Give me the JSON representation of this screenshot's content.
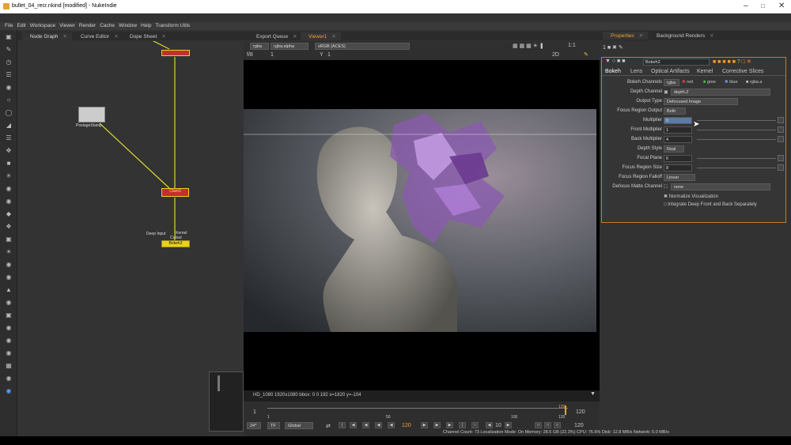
{
  "window": {
    "title": "bullet_04_recr.nkind [modified] - NukeIndie"
  },
  "menu": [
    "File",
    "Edit",
    "Workspace",
    "Viewer",
    "Render",
    "Cache",
    "Window",
    "Help",
    "Transform Utils"
  ],
  "left_tabs": {
    "node_graph": "Node Graph",
    "curve_editor": "Curve Editor",
    "dope_sheet": "Dope Sheet"
  },
  "center_tabs": {
    "export_queue": "Export Queue",
    "viewer": "Viewer1"
  },
  "right_tabs": {
    "properties": "Properties",
    "background_renders": "Background Renders"
  },
  "nodes": {
    "postage": "PostageStamp",
    "merge": "Clam3",
    "bokeh": "Bokeh2",
    "deep_label": "Deep Input",
    "kernel_label": "Kernel",
    "cutout_label": "Cutout"
  },
  "viewer": {
    "channel_set": "rgba",
    "alpha": "rgba.alpha",
    "colorspace": "sRGB (ACES)",
    "fstop": "f/8",
    "gain": "1",
    "y_label": "Y",
    "gamma": "1",
    "zoom": "1:1",
    "view_mode": "2D",
    "info": "HD_1080 1920x1080  bbox: 0 0 192  x=1820 y=-104"
  },
  "timeline": {
    "start": "1",
    "end": "120",
    "tick_50": "50",
    "tick_100": "100",
    "tick_120": "120",
    "current": "120",
    "fps": "24*",
    "tf": "TF",
    "scope": "Global",
    "frame": "120",
    "step": "10",
    "out_frame": "120",
    "playhead": 0.992
  },
  "properties": {
    "node_name": "Bokeh2",
    "tabs": [
      "Bokeh",
      "Lens",
      "Optical Artifacts",
      "Kernel",
      "Corrective Slices"
    ],
    "bokeh_channels": {
      "label": "Bokeh Channels",
      "value": "rgba",
      "red": "red",
      "green": "gree",
      "blue": "blue",
      "alpha": "rgba.a"
    },
    "depth_channel": {
      "label": "Depth Channel",
      "value": "depth.Z"
    },
    "output_type": {
      "label": "Output Type",
      "value": "Defocused Image"
    },
    "focus_region_output": {
      "label": "Focus Region Output",
      "value": "Both"
    },
    "multiplier": {
      "label": "Multiplier",
      "value": "0"
    },
    "front_multiplier": {
      "label": "Front Multiplier",
      "value": "1"
    },
    "back_multiplier": {
      "label": "Back Multiplier",
      "value": "4"
    },
    "depth_style": {
      "label": "Depth Style",
      "value": "Real"
    },
    "focal_plane": {
      "label": "Focal Plane",
      "value": "6"
    },
    "focus_region_size": {
      "label": "Focus Region Size",
      "value": "8"
    },
    "focus_region_falloff": {
      "label": "Focus Region Falloff",
      "value": "Linear"
    },
    "defocus_matte": {
      "label": "Defocus Matte Channel",
      "value": "none"
    },
    "normalize": "Normalize Visualization",
    "integrate": "Integrate Deep Front and Back Separately"
  },
  "status": "Channel Count: 73  Localization Mode: On  Memory: 28.5 GB (22.3%)  CPU: 76.6%  Disk: 12.8 MB/s  Network: 0.0 MB/s",
  "colors": {
    "accent": "#f0a030",
    "node_yellow": "#e8d020",
    "node_red": "#c03030",
    "wire": "#d8d830"
  }
}
